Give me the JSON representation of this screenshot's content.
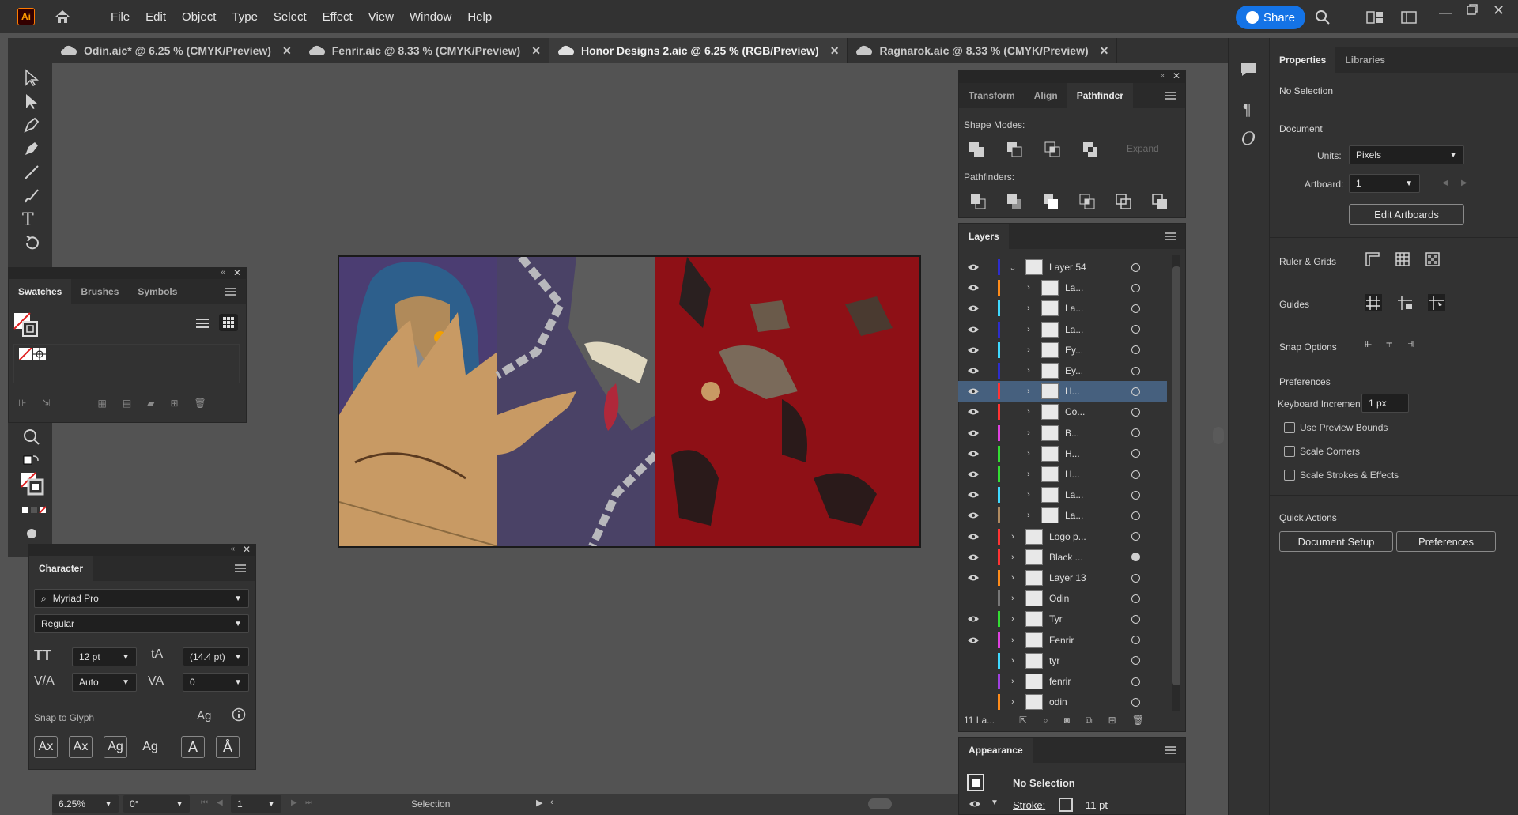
{
  "app": {
    "logo_text": "Ai"
  },
  "menu": [
    "File",
    "Edit",
    "Object",
    "Type",
    "Select",
    "Effect",
    "View",
    "Window",
    "Help"
  ],
  "share_label": "Share",
  "tabs": [
    {
      "label": "Odin.aic* @ 6.25 % (CMYK/Preview)",
      "active": false
    },
    {
      "label": "Fenrir.aic @ 8.33 % (CMYK/Preview)",
      "active": false
    },
    {
      "label": "Honor Designs 2.aic @ 6.25 % (RGB/Preview)",
      "active": true
    },
    {
      "label": "Ragnarok.aic @ 8.33 % (CMYK/Preview)",
      "active": false
    }
  ],
  "swatches_panel": {
    "tabs": [
      "Swatches",
      "Brushes",
      "Symbols"
    ]
  },
  "character_panel": {
    "title": "Character",
    "font_family": "Myriad Pro",
    "font_style": "Regular",
    "font_size": "12 pt",
    "leading": "(14.4 pt)",
    "kerning": "Auto",
    "tracking": "0",
    "snap_label": "Snap to Glyph"
  },
  "pathfinder_panel": {
    "tabs": [
      "Transform",
      "Align",
      "Pathfinder"
    ],
    "shape_modes_label": "Shape Modes:",
    "expand_label": "Expand",
    "pathfinders_label": "Pathfinders:"
  },
  "layers_panel": {
    "title": "Layers",
    "count_label": "11 La...",
    "rows": [
      {
        "name": "Layer 54",
        "color": "#2d2dcc",
        "visible": true,
        "expanded": true,
        "indent": 0,
        "selected": false,
        "target_filled": false
      },
      {
        "name": "La...",
        "color": "#ff8c1a",
        "visible": true,
        "expanded": false,
        "indent": 1,
        "selected": false,
        "target_filled": false
      },
      {
        "name": "La...",
        "color": "#3fd9ff",
        "visible": true,
        "expanded": false,
        "indent": 1,
        "selected": false,
        "target_filled": false
      },
      {
        "name": "La...",
        "color": "#2d2dcc",
        "visible": true,
        "expanded": false,
        "indent": 1,
        "selected": false,
        "target_filled": false
      },
      {
        "name": "Ey...",
        "color": "#3fd9ff",
        "visible": true,
        "expanded": false,
        "indent": 1,
        "selected": false,
        "target_filled": false
      },
      {
        "name": "Ey...",
        "color": "#2d2dcc",
        "visible": true,
        "expanded": false,
        "indent": 1,
        "selected": false,
        "target_filled": false
      },
      {
        "name": "H...",
        "color": "#ff3333",
        "visible": true,
        "expanded": false,
        "indent": 1,
        "selected": true,
        "target_filled": false
      },
      {
        "name": "Co...",
        "color": "#ff3333",
        "visible": true,
        "expanded": false,
        "indent": 1,
        "selected": false,
        "target_filled": false
      },
      {
        "name": "B...",
        "color": "#e040e0",
        "visible": true,
        "expanded": false,
        "indent": 1,
        "selected": false,
        "target_filled": false
      },
      {
        "name": "H...",
        "color": "#33dd33",
        "visible": true,
        "expanded": false,
        "indent": 1,
        "selected": false,
        "target_filled": false
      },
      {
        "name": "H...",
        "color": "#33dd33",
        "visible": true,
        "expanded": false,
        "indent": 1,
        "selected": false,
        "target_filled": false
      },
      {
        "name": "La...",
        "color": "#3fd9ff",
        "visible": true,
        "expanded": false,
        "indent": 1,
        "selected": false,
        "target_filled": false
      },
      {
        "name": "La...",
        "color": "#b08a60",
        "visible": true,
        "expanded": false,
        "indent": 1,
        "selected": false,
        "target_filled": false
      },
      {
        "name": "Logo p...",
        "color": "#ff3333",
        "visible": true,
        "expanded": false,
        "indent": 0,
        "selected": false,
        "target_filled": false
      },
      {
        "name": "Black ...",
        "color": "#ff3333",
        "visible": true,
        "expanded": false,
        "indent": 0,
        "selected": false,
        "target_filled": true
      },
      {
        "name": "Layer 13",
        "color": "#ff8c1a",
        "visible": true,
        "expanded": false,
        "indent": 0,
        "selected": false,
        "target_filled": false
      },
      {
        "name": "Odin",
        "color": "#777777",
        "visible": false,
        "expanded": false,
        "indent": 0,
        "selected": false,
        "target_filled": false
      },
      {
        "name": "Tyr",
        "color": "#33dd33",
        "visible": true,
        "expanded": false,
        "indent": 0,
        "selected": false,
        "target_filled": false
      },
      {
        "name": "Fenrir",
        "color": "#e040e0",
        "visible": true,
        "expanded": false,
        "indent": 0,
        "selected": false,
        "target_filled": false
      },
      {
        "name": "tyr",
        "color": "#3fd9ff",
        "visible": false,
        "expanded": false,
        "indent": 0,
        "selected": false,
        "target_filled": false
      },
      {
        "name": "fenrir",
        "color": "#a040e0",
        "visible": false,
        "expanded": false,
        "indent": 0,
        "selected": false,
        "target_filled": false
      },
      {
        "name": "odin",
        "color": "#ff8c1a",
        "visible": false,
        "expanded": false,
        "indent": 0,
        "selected": false,
        "target_filled": false
      }
    ]
  },
  "appearance_panel": {
    "title": "Appearance",
    "selection_label": "No Selection",
    "stroke_label": "Stroke:",
    "stroke_value": "11 pt"
  },
  "properties_panel": {
    "tabs": [
      "Properties",
      "Libraries"
    ],
    "selection_label": "No Selection",
    "document_label": "Document",
    "units_label": "Units:",
    "units_value": "Pixels",
    "artboard_label": "Artboard:",
    "artboard_value": "1",
    "edit_artboards_label": "Edit Artboards",
    "ruler_grids_label": "Ruler & Grids",
    "guides_label": "Guides",
    "snap_options_label": "Snap Options",
    "preferences_label": "Preferences",
    "keyboard_increment_label": "Keyboard Increment:",
    "keyboard_increment_value": "1 px",
    "checkboxes": [
      "Use Preview Bounds",
      "Scale Corners",
      "Scale Strokes & Effects"
    ],
    "quick_actions_label": "Quick Actions",
    "document_setup_label": "Document Setup",
    "preferences_button_label": "Preferences"
  },
  "status_bar": {
    "zoom": "6.25%",
    "rotation": "0°",
    "artboard_number": "1",
    "tool_label": "Selection"
  }
}
